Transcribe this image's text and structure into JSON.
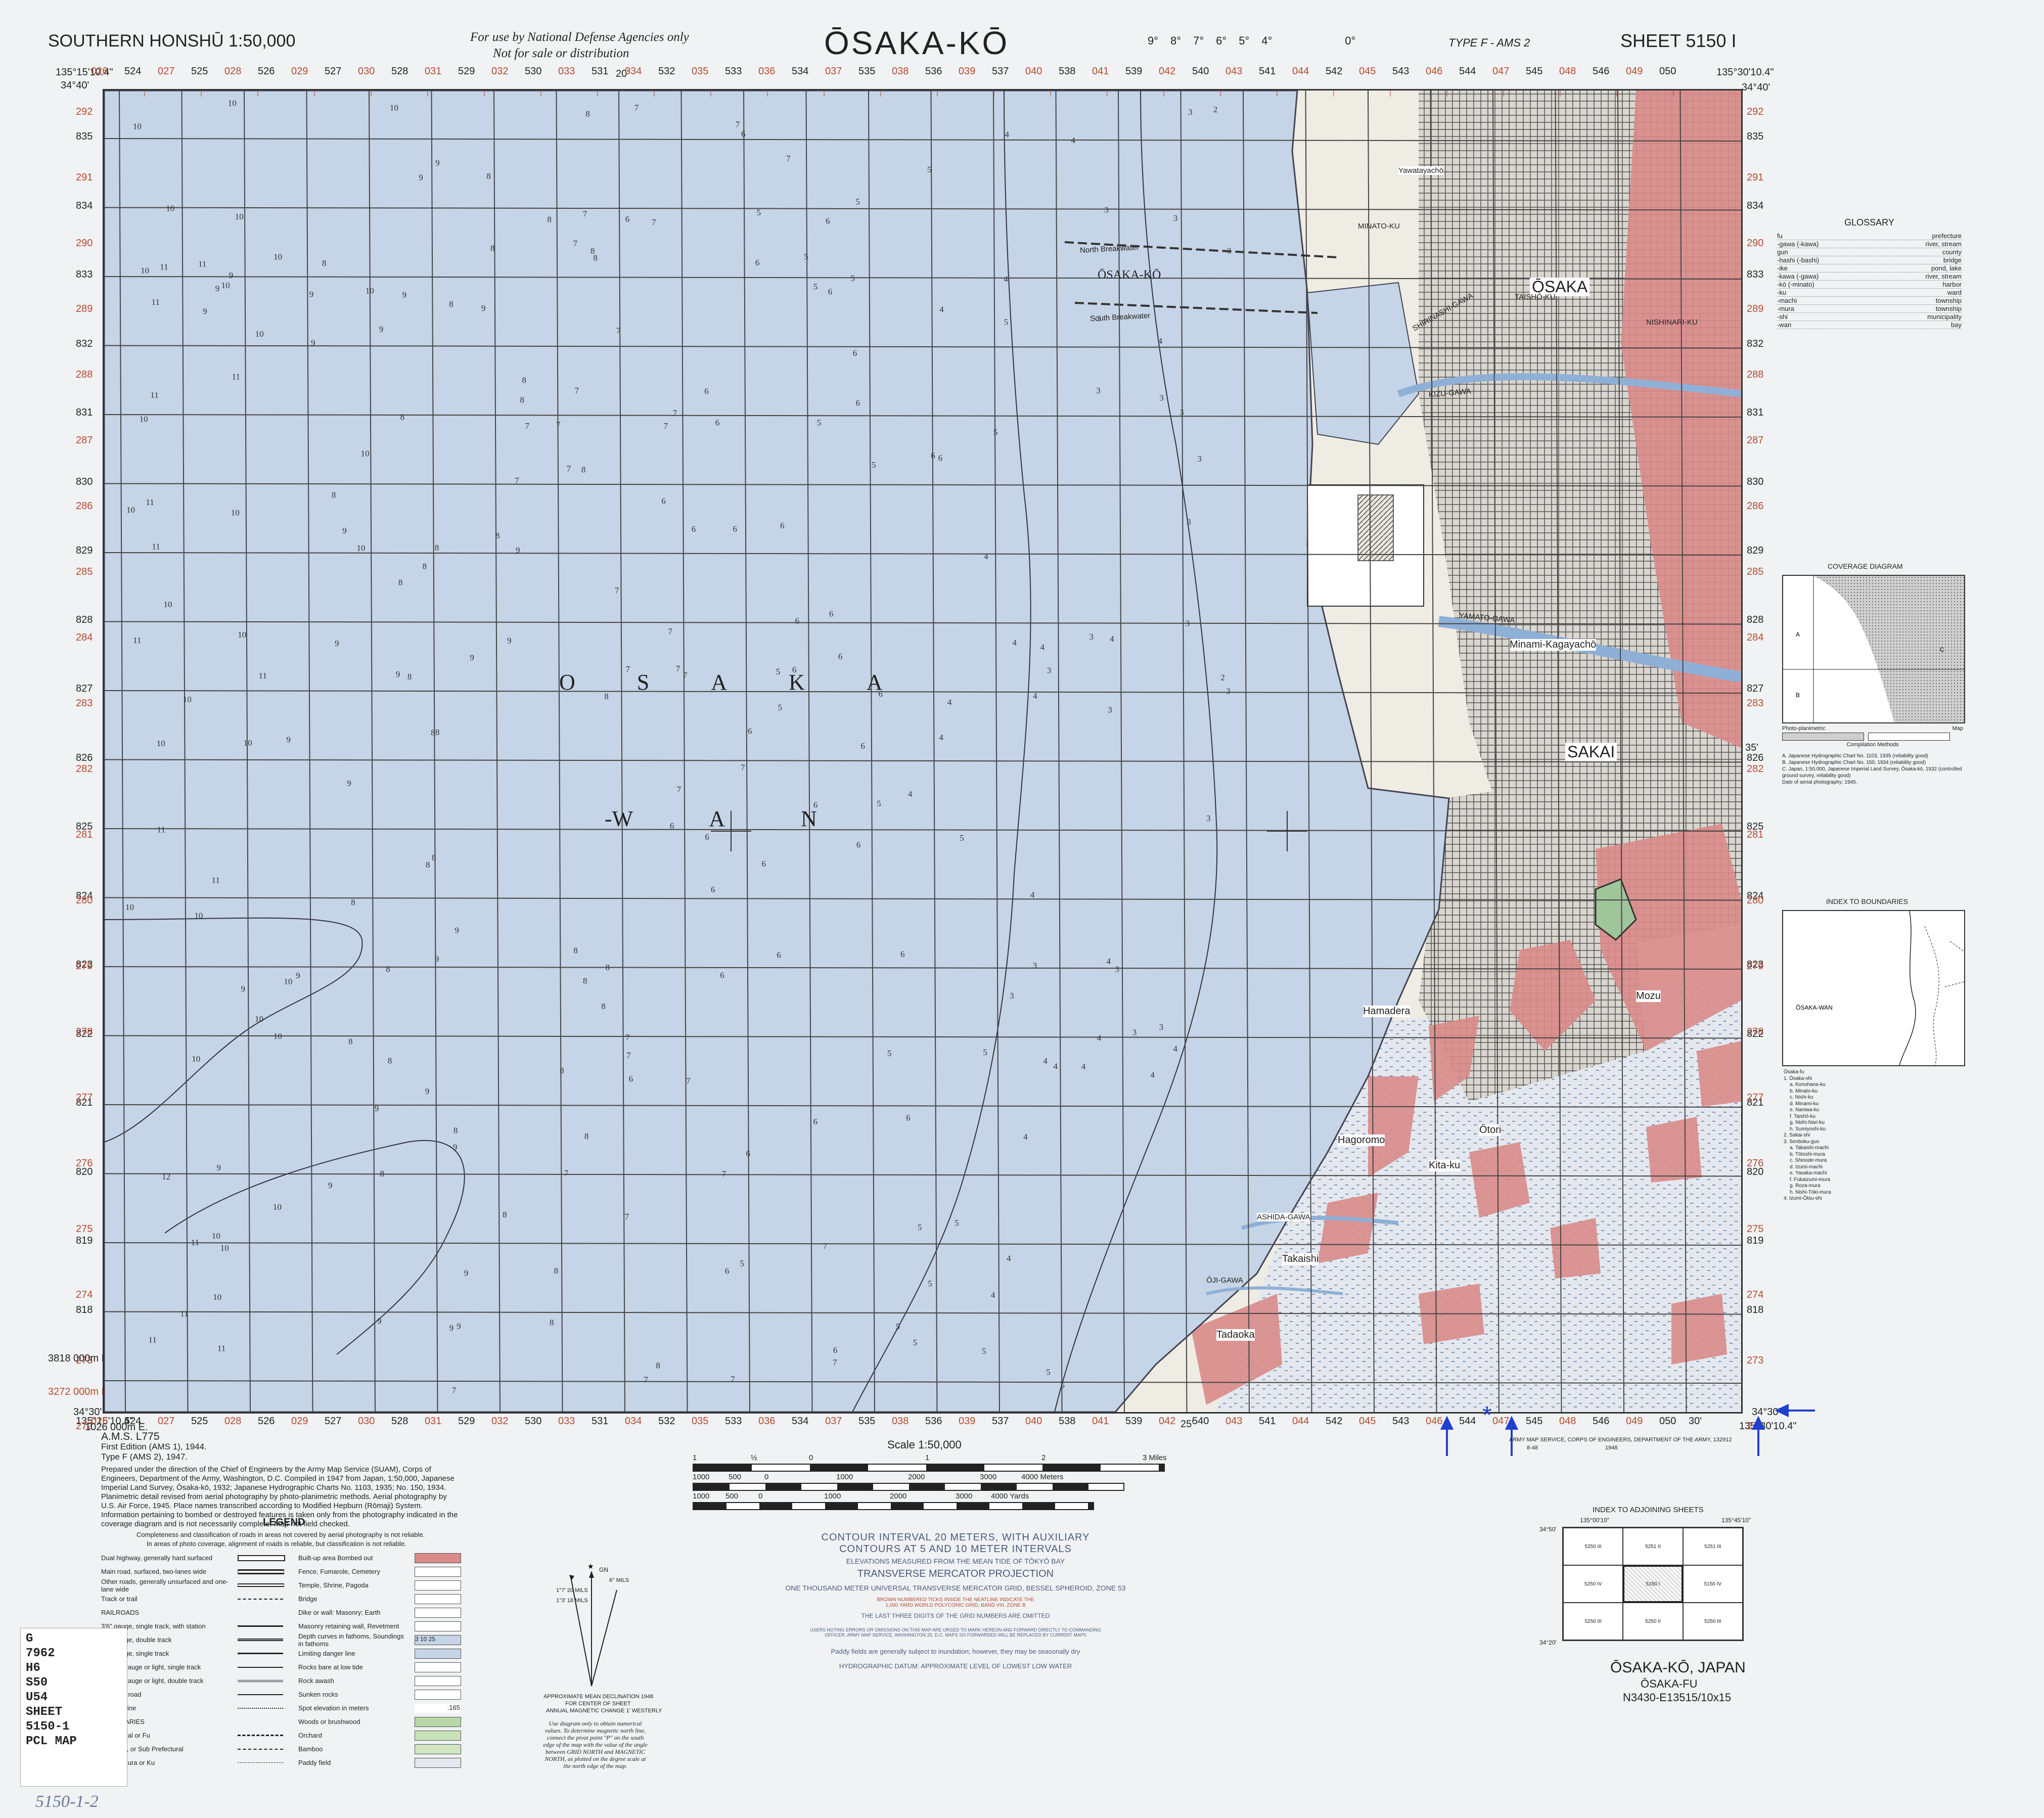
{
  "header": {
    "series": "SOUTHERN HONSHŪ 1:50,000",
    "restriction_line1": "For use by National Defense Agencies only",
    "restriction_line2": "Not for sale or distribution",
    "title": "ŌSAKA-KŌ",
    "type": "TYPE F - AMS 2",
    "sheet": "SHEET 5150 I",
    "declination_ticks": [
      "9°",
      "8°",
      "7°",
      "6°",
      "5°",
      "4°",
      "0°"
    ]
  },
  "corners": {
    "nw_lon": "135°15'10.4\"",
    "ne_lon": "135°30'10.4\"",
    "nw_lat": "34°40'",
    "ne_lat": "34°40'",
    "sw_lat": "34°30'",
    "se_lat": "34°30'",
    "sw_lon": "135°15'10.4\"",
    "se_lon": "135°30'10.4\"",
    "mid_lon": "20'",
    "mid_lon2": "25'",
    "mid_lat": "35'",
    "mid_lon3": "30'"
  },
  "grid": {
    "top_easting_labels": [
      "026",
      "524",
      "027",
      "525",
      "028",
      "526",
      "029",
      "527",
      "030",
      "528",
      "031",
      "529",
      "032",
      "530",
      "033",
      "531",
      "034",
      "532",
      "035",
      "533",
      "036",
      "534",
      "037",
      "535",
      "038",
      "536",
      "039",
      "537",
      "040",
      "538",
      "041",
      "539",
      "042",
      "540",
      "043",
      "541",
      "044",
      "542",
      "045",
      "543",
      "046",
      "544",
      "047",
      "545",
      "048",
      "546",
      "049",
      "050"
    ],
    "northings_black": [
      "835",
      "834",
      "833",
      "832",
      "831",
      "830",
      "829",
      "828",
      "827",
      "826",
      "825",
      "824",
      "823",
      "822",
      "821",
      "820",
      "819",
      "818"
    ],
    "northings_red": [
      "292",
      "291",
      "290",
      "289",
      "288",
      "287",
      "286",
      "285",
      "284",
      "283",
      "282",
      "281",
      "280",
      "279",
      "278",
      "277",
      "276",
      "275",
      "274",
      "273",
      "272"
    ],
    "bottom_easting_left": "1026 000m E.",
    "bottom_north_left": "3818 000m N.",
    "bottom_red_left": "3272 000m N."
  },
  "water_labels": {
    "osaka_letters": [
      "O",
      "S",
      "A",
      "K",
      "A"
    ],
    "wan_letters": [
      "-W",
      "A",
      "N"
    ]
  },
  "places": {
    "osaka": "ŌSAKA",
    "sakai": "SAKAI",
    "osaka_ko": "ŌSAKA-KŌ",
    "north_breakwater": "North Breakwater",
    "south_breakwater": "South Breakwater",
    "yamato_gawa": "YAMATO-GAWA",
    "kizu_gawa": "KIZU-GAWA",
    "shirinashi_gawa": "SHIRINASHI-GAWA",
    "ashida_gawa": "ASHIDA-GAWA",
    "oji_gawa": "ŌJI-GAWA",
    "minami_kagaya": "Minami-Kagayachō",
    "hamadera": "Hamadera",
    "takaishi": "Takaishi",
    "hagoromo": "Hagoromo",
    "kita_ku": "Kita-ku",
    "otori": "Ōtori",
    "mozu": "Mozu",
    "tadaoka": "Tadaoka",
    "yawata": "Yawatayachō",
    "minato_ku": "MINATO-KU",
    "taisho_ku": "TAISHŌ-KU",
    "nishinari_ku": "NISHINARI-KU"
  },
  "marginalia": {
    "ams": "A.M.S. L775",
    "edition1": "First Edition (AMS 1), 1944.",
    "edition2": "Type F (AMS 2), 1947.",
    "compilation_note": "Prepared under the direction of the Chief of Engineers by the Army Map Service (SUAM), Corps of Engineers, Department of the Army, Washington, D.C. Compiled in 1947 from Japan, 1:50,000, Japanese Imperial Land Survey, Ōsaka-kō, 1932; Japanese Hydrographic Charts No. 1103, 1935; No. 150, 1934. Planimetric detail revised from aerial photography by photo-planimetric methods. Aerial photography by U.S. Air Force, 1945. Place names transcribed according to Modified Hepburn (Rōmaji) System. Information pertaining to bombed or destroyed features is taken only from the photography indicated in the coverage diagram and is not necessarily complete. Map not field checked.",
    "army_service": "ARMY MAP SERVICE, CORPS OF ENGINEERS, DEPARTMENT OF THE ARMY, 132912",
    "army_service_code": "8-48",
    "army_service_year": "1948"
  },
  "legend": {
    "title": "LEGEND",
    "note_line1": "Completeness and classification of roads in areas not covered by aerial photography is not reliable.",
    "note_line2": "In areas of photo coverage, alignment of roads is reliable, but classification is not reliable.",
    "left_items": [
      "Dual highway, generally hard surfaced",
      "Main road, surfaced, two-lanes wide",
      "Other roads, generally unsurfaced and one-lane wide",
      "Track or trail",
      "RAILROADS",
      "3'6\" gauge, single track, with station",
      "3'6\" gauge, double track",
      "3'6\" gauge, single track",
      "Narrow gauge or light, single track",
      "Narrow gauge or light, double track",
      "Street or road",
      "Division line",
      "BOUNDARIES",
      "Prefectural or Fu",
      "Gun, Shi, or Sub Prefectural",
      "Machi, Mura or Ku"
    ],
    "right_items": [
      "Built-up area  Bombed out",
      "Fence, Fumarole, Cemetery",
      "Temple, Shrine, Pagoda",
      "Bridge",
      "Dike or wall: Masonry; Earth",
      "Masonry retaining wall, Revetment",
      "Depth curves in fathoms, Soundings in fathoms",
      "Limiting danger line",
      "Rocks bare at low tide",
      "Rock awash",
      "Sunken rocks",
      "Spot elevation in meters",
      "Woods or brushwood",
      "Orchard",
      "Bamboo",
      "Paddy field"
    ],
    "spot_elev": ".165",
    "depth_vals": "3  10  25"
  },
  "scale": {
    "title": "Scale 1:50,000",
    "miles_labels": [
      "1",
      "½",
      "0",
      "1",
      "2",
      "3 Miles"
    ],
    "meters_labels": [
      "1000",
      "500",
      "0",
      "1000",
      "2000",
      "3000",
      "4000 Meters"
    ],
    "yards_labels": [
      "1000",
      "500",
      "0",
      "1000",
      "2000",
      "3000",
      "4000 Yards"
    ]
  },
  "notes": {
    "contour1": "CONTOUR INTERVAL 20 METERS, WITH AUXILIARY",
    "contour2": "CONTOURS AT 5 AND 10 METER INTERVALS",
    "elevations": "ELEVATIONS MEASURED FROM THE MEAN TIDE OF TŌKYŌ BAY",
    "projection": "TRANSVERSE MERCATOR PROJECTION",
    "grid": "ONE THOUSAND METER UNIVERSAL TRANSVERSE MERCATOR GRID, BESSEL SPHEROID, ZONE 53",
    "brown_ticks1": "BROWN NUMBERED TICKS INSIDE THE NEATLINE INDICATE THE",
    "brown_ticks2": "1,000 YARD WORLD POLYCONIC GRID, BAND VIII, ZONE B",
    "three_digits": "THE LAST THREE DIGITS OF THE GRID NUMBERS ARE OMITTED",
    "errors1": "USERS NOTING ERRORS OR OMISSIONS ON THIS MAP ARE URGED TO MARK HEREON AND FORWARD DIRECTLY TO COMMANDING",
    "errors2": "OFFICER, ARMY MAP SERVICE, WASHINGTON 25, D.C. MAPS SO FORWARDED WILL BE REPLACED BY CURRENT MAPS",
    "paddy": "Paddy fields are generally subject to inundation; however, they may be seasonally dry",
    "datum": "HYDROGRAPHIC DATUM: APPROXIMATE LEVEL OF LOWEST LOW WATER"
  },
  "declination": {
    "caption1": "APPROXIMATE MEAN DECLINATION 1948",
    "caption2": "FOR CENTER OF SHEET",
    "caption3": "ANNUAL MAGNETIC CHANGE 1' WESTERLY",
    "instructions": "Use diagram only to obtain numerical values. To determine magnetic north line, connect the pivot point \"P\" on the south edge of the map with the value of the angle between GRID NORTH and MAGNETIC NORTH, as plotted on the degree scale at the north edge of the map.",
    "gn": "GN",
    "mils1": "6° MILS",
    "mils2": "1°7' 20 MILS",
    "mils3": "1°3' 18 MILS"
  },
  "glossary": {
    "title": "GLOSSARY",
    "items": [
      [
        "fu",
        "prefecture"
      ],
      [
        "-gawa (-kawa)",
        "river, stream"
      ],
      [
        "gun",
        "county"
      ],
      [
        "-hashi (-bashi)",
        "bridge"
      ],
      [
        "-ike",
        "pond, lake"
      ],
      [
        "-kawa (-gawa)",
        "river, stream"
      ],
      [
        "-kō (-minato)",
        "harbor"
      ],
      [
        "-ku",
        "ward"
      ],
      [
        "-machi",
        "township"
      ],
      [
        "-mura",
        "township"
      ],
      [
        "-shi",
        "municipality"
      ],
      [
        "-wan",
        "bay"
      ]
    ]
  },
  "coverage": {
    "title": "COVERAGE DIAGRAM",
    "legend_left": "Photo-planimetric",
    "legend_right": "Map",
    "caption": "Compilation Methods",
    "labels": [
      "A",
      "B",
      "C"
    ],
    "notes": [
      "A. Japanese Hydrographic Chart No. 1103, 1935 (reliability good)",
      "B. Japanese Hydrographic Chart No. 150, 1934 (reliability good)",
      "C. Japan, 1:50,000, Japanese Imperial Land Survey, Ōsaka-kō, 1932 (controlled ground survey, reliability good)",
      "Date of aerial photography: 1945."
    ]
  },
  "boundaries": {
    "title": "INDEX TO BOUNDARIES",
    "wan_label": "ŌSAKA-WAN",
    "list": [
      "Ōsaka-fu",
      "1. Ōsaka-shi",
      "a. Konohana-ku",
      "b. Minato-ku",
      "c. Nishi-ku",
      "d. Minami-ku",
      "e. Naniwa-ku",
      "f. Taishō-ku",
      "g. Nishi-Nari-ku",
      "h. Sumiyoshi-ku",
      "2. Sakai-shi",
      "3. Senboku-gun",
      "a. Takaishi-machi",
      "b. Tōtoshi-mura",
      "c. Shinode-mura",
      "d. Izumi-machi",
      "e. Yasaka-machi",
      "f. Fukaizumi-mura",
      "g. Roza-mura",
      "h. Nishi-Tōki-mura",
      "4. Izumi-Ōtsu-shi"
    ]
  },
  "adjoining": {
    "title": "INDEX TO ADJOINING SHEETS",
    "lon_left": "135°00'10\"",
    "lon_right": "135°45'10\"",
    "lat_top": "34°50'",
    "lat_bottom": "34°20'",
    "sheets": [
      "5250 III",
      "5251 II",
      "5251 III",
      "5250 IV",
      "5150 I",
      "5150 IV",
      "5250 III",
      "5250 II",
      "5250 III"
    ]
  },
  "footer": {
    "name": "ŌSAKA-KŌ, JAPAN",
    "prefecture": "ŌSAKA-FU",
    "code": "N3430-E13515/10x15"
  },
  "call_number": {
    "lines": [
      "G",
      "7962",
      "H6",
      "S50",
      "U54",
      "SHEET",
      "5150-1",
      "PCL MAP"
    ],
    "handwritten": "5150-1-2"
  },
  "colors": {
    "water": "#c5d4e6",
    "land": "#efece4",
    "builtup": "#d98b89",
    "grid": "#444444",
    "red_text": "#b44a2e",
    "arrow": "#1f3fcf"
  }
}
